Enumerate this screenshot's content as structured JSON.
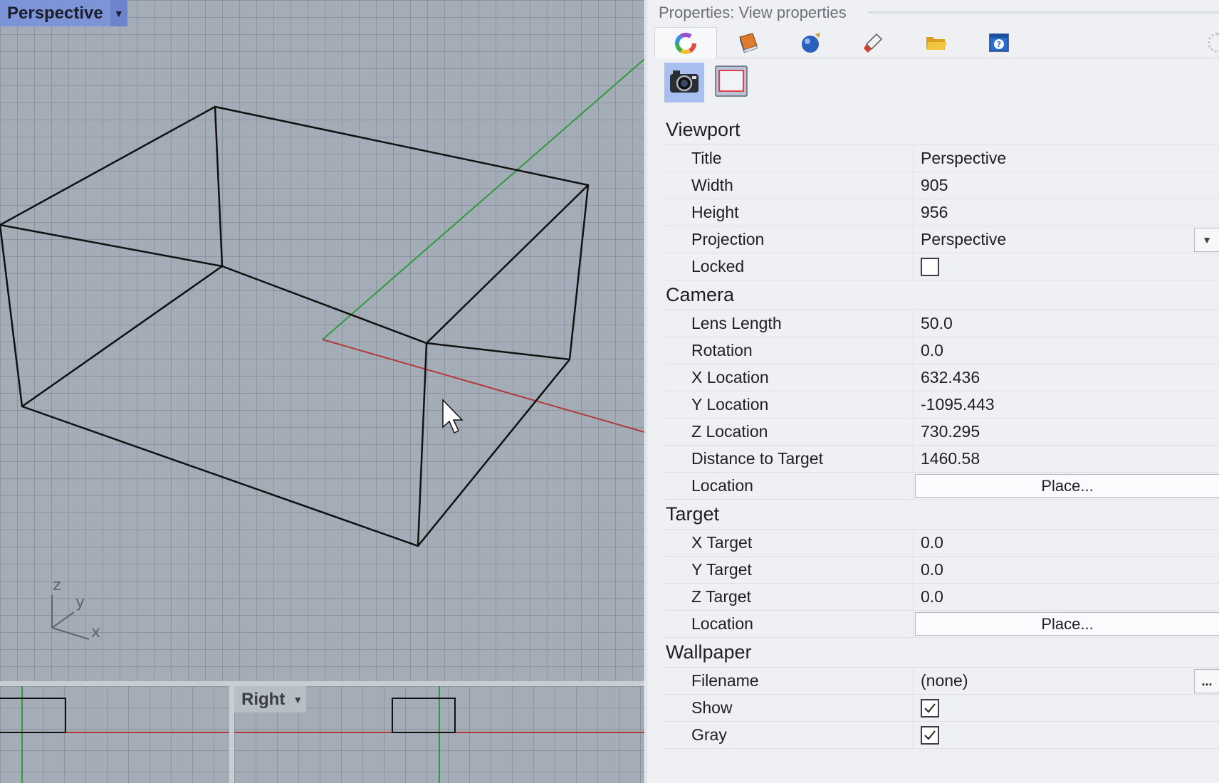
{
  "viewports": {
    "main": {
      "title": "Perspective"
    },
    "right": {
      "title": "Right"
    },
    "axes": {
      "z": "z",
      "y": "y",
      "x": "x"
    }
  },
  "panel": {
    "header": "Properties: View properties",
    "tabs": [
      {
        "icon": "color-wheel-icon"
      },
      {
        "icon": "material-book-icon"
      },
      {
        "icon": "environment-sphere-icon"
      },
      {
        "icon": "paint-brush-icon"
      },
      {
        "icon": "folder-open-icon"
      },
      {
        "icon": "help-icon"
      }
    ],
    "subicons": [
      {
        "icon": "camera-icon",
        "active": true
      },
      {
        "icon": "viewport-frame-icon",
        "active": false
      }
    ],
    "sections": {
      "viewport": {
        "title": "Viewport",
        "title_label": "Title",
        "title_value": "Perspective",
        "width_label": "Width",
        "width_value": "905",
        "height_label": "Height",
        "height_value": "956",
        "projection_label": "Projection",
        "projection_value": "Perspective",
        "locked_label": "Locked",
        "locked_value": false
      },
      "camera": {
        "title": "Camera",
        "lens_label": "Lens Length",
        "lens_value": "50.0",
        "rotation_label": "Rotation",
        "rotation_value": "0.0",
        "xloc_label": "X Location",
        "xloc_value": "632.436",
        "yloc_label": "Y Location",
        "yloc_value": "-1095.443",
        "zloc_label": "Z Location",
        "zloc_value": "730.295",
        "dist_label": "Distance to Target",
        "dist_value": "1460.58",
        "location_label": "Location",
        "place_label": "Place..."
      },
      "target": {
        "title": "Target",
        "xt_label": "X Target",
        "xt_value": "0.0",
        "yt_label": "Y Target",
        "yt_value": "0.0",
        "zt_label": "Z Target",
        "zt_value": "0.0",
        "location_label": "Location",
        "place_label": "Place..."
      },
      "wallpaper": {
        "title": "Wallpaper",
        "filename_label": "Filename",
        "filename_value": "(none)",
        "browse_label": "...",
        "show_label": "Show",
        "show_value": true,
        "gray_label": "Gray",
        "gray_value": true
      }
    }
  },
  "colors": {
    "tab_active": "#7d94d8",
    "x_axis": "#b23a3a",
    "y_axis": "#2f9a3a",
    "subicon_active": "#a8bff0"
  }
}
